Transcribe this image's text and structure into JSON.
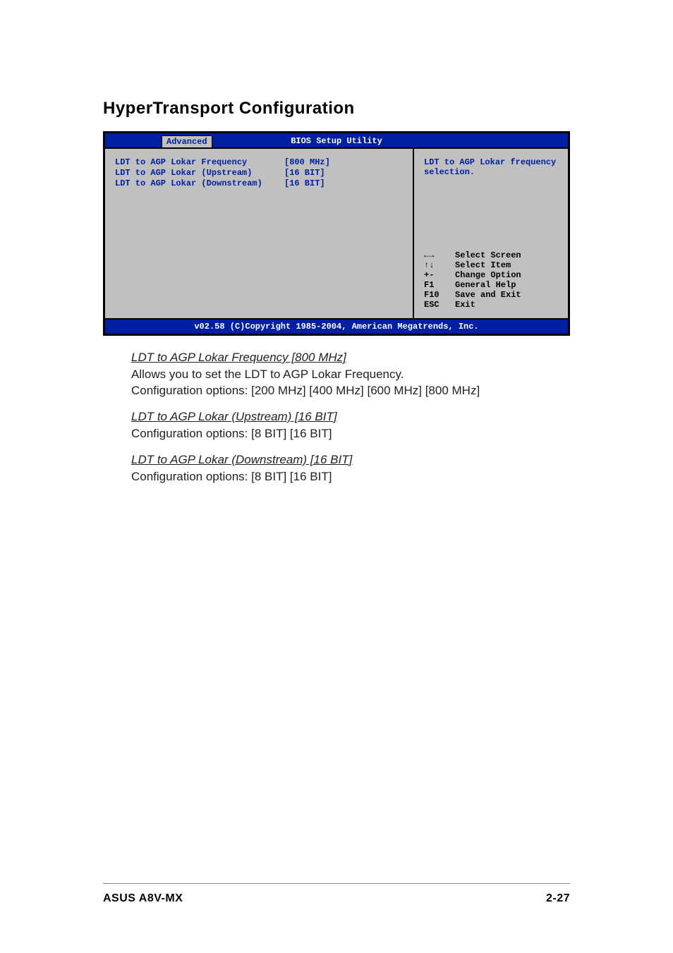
{
  "heading": "HyperTransport Configuration",
  "bios": {
    "title": "BIOS Setup Utility",
    "tab": "Advanced",
    "rows": [
      {
        "label": "LDT to AGP Lokar Frequency",
        "value": "[800 MHz]"
      },
      {
        "label": "LDT to AGP Lokar (Upstream)",
        "value": "[16 BIT]"
      },
      {
        "label": "LDT to AGP Lokar (Downstream)",
        "value": "[16 BIT]"
      }
    ],
    "help_text": "LDT to AGP Lokar frequency selection.",
    "keys": [
      {
        "key": "←→",
        "desc": "Select Screen"
      },
      {
        "key": "↑↓",
        "desc": "Select Item"
      },
      {
        "key": "+-",
        "desc": "Change Option"
      },
      {
        "key": "F1",
        "desc": "General Help"
      },
      {
        "key": "F10",
        "desc": "Save and Exit"
      },
      {
        "key": "ESC",
        "desc": "Exit"
      }
    ],
    "footer": "v02.58 (C)Copyright 1985-2004, American Megatrends, Inc."
  },
  "doc": {
    "items": [
      {
        "title": "LDT to AGP Lokar Frequency [800 MHz]",
        "desc": "Allows you to set the LDT to AGP Lokar Frequency.\nConfiguration options: [200 MHz] [400 MHz] [600 MHz] [800 MHz]"
      },
      {
        "title": "LDT to AGP Lokar (Upstream) [16 BIT]",
        "desc": "Configuration options: [8 BIT] [16 BIT]"
      },
      {
        "title": "LDT to AGP Lokar (Downstream) [16 BIT]",
        "desc": "Configuration options: [8 BIT] [16 BIT]"
      }
    ]
  },
  "footer": {
    "left": "ASUS A8V-MX",
    "right": "2-27"
  }
}
